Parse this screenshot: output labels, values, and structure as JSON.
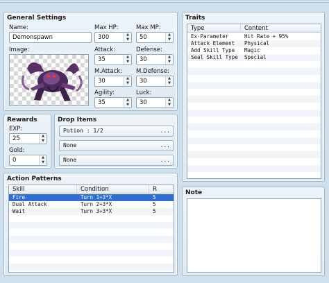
{
  "general": {
    "title": "General Settings",
    "name_label": "Name:",
    "name_value": "Demonspawn",
    "image_label": "Image:",
    "maxhp_label": "Max HP:",
    "maxhp_value": "300",
    "maxmp_label": "Max MP:",
    "maxmp_value": "50",
    "attack_label": "Attack:",
    "attack_value": "35",
    "defense_label": "Defense:",
    "defense_value": "30",
    "mattack_label": "M.Attack:",
    "mattack_value": "30",
    "mdefense_label": "M.Defense:",
    "mdefense_value": "30",
    "agility_label": "Agility:",
    "agility_value": "35",
    "luck_label": "Luck:",
    "luck_value": "30"
  },
  "rewards": {
    "title": "Rewards",
    "exp_label": "EXP:",
    "exp_value": "25",
    "gold_label": "Gold:",
    "gold_value": "0"
  },
  "drops": {
    "title": "Drop Items",
    "items": [
      "Potion : 1/2",
      "None",
      "None"
    ],
    "more": "..."
  },
  "actions": {
    "title": "Action Patterns",
    "columns": [
      "Skill",
      "Condition",
      "R"
    ],
    "rows": [
      {
        "skill": "Fire",
        "condition": "Turn 1+3*X",
        "r": "5"
      },
      {
        "skill": "Dual Attack",
        "condition": "Turn 2+3*X",
        "r": "5"
      },
      {
        "skill": "Wait",
        "condition": "Turn 3+3*X",
        "r": "5"
      }
    ]
  },
  "traits": {
    "title": "Traits",
    "columns": [
      "Type",
      "Content"
    ],
    "rows": [
      {
        "type": "Ex-Parameter",
        "content": "Hit Rate + 95%"
      },
      {
        "type": "Attack Element",
        "content": "Physical"
      },
      {
        "type": "Add Skill Type",
        "content": "Magic"
      },
      {
        "type": "Seal Skill Type",
        "content": "Special"
      }
    ]
  },
  "note": {
    "title": "Note"
  },
  "colors": {
    "selection": "#2f6fcf",
    "panel": "#e6eef5",
    "background": "#cfe0ec"
  }
}
